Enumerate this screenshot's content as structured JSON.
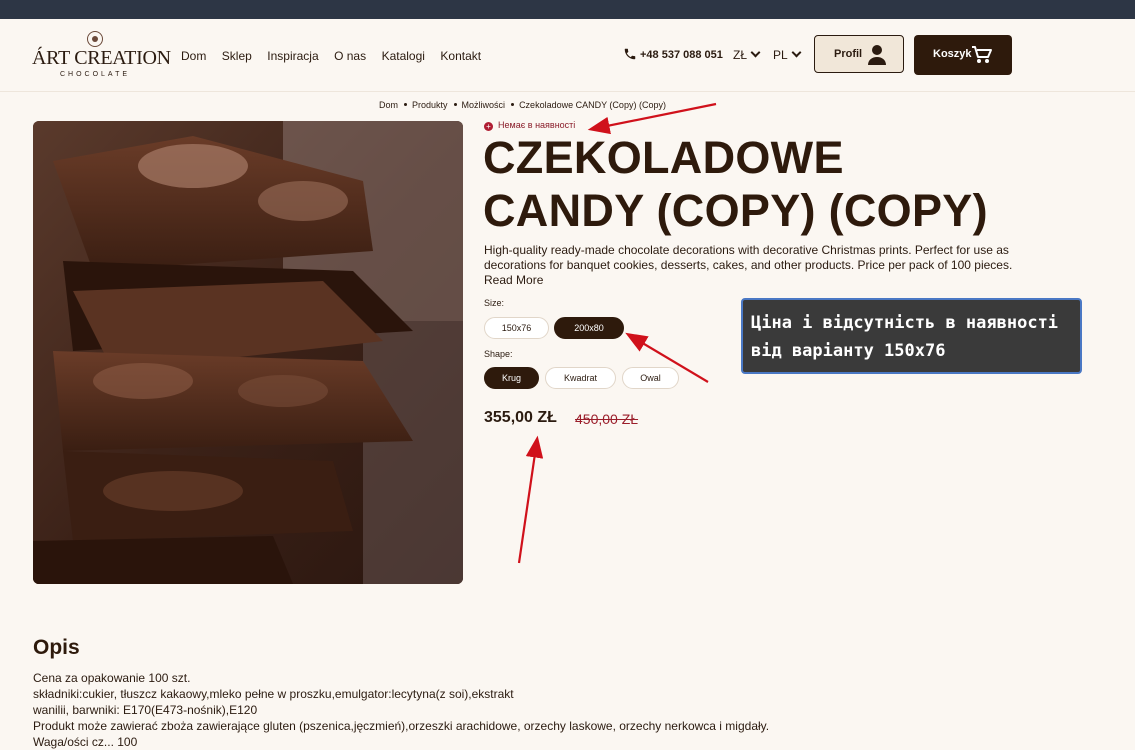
{
  "brand": {
    "name": "ÁRT CREATION",
    "tagline": "CHOCOLATE"
  },
  "nav": [
    "Dom",
    "Sklep",
    "Inspiracja",
    "O nas",
    "Katalogi",
    "Kontakt"
  ],
  "header": {
    "phone": "+48 537 088 051",
    "currency": "ZŁ",
    "language": "PL",
    "profile_label": "Profil",
    "cart_label": "Koszyk"
  },
  "breadcrumb": [
    "Dom",
    "Produkty",
    "Możliwości",
    "Czekoladowe CANDY (Copy) (Copy)"
  ],
  "product": {
    "stock_status": "Немає в наявності",
    "title_line1": "CZEKOLADOWE",
    "title_line2": "CANDY (COPY) (COPY)",
    "description": "High-quality ready-made chocolate decorations with decorative Christmas prints. Perfect for use as decorations for banquet cookies, desserts, cakes, and other products. Price per pack of 100 pieces.",
    "read_more": "Read More",
    "size_label": "Size:",
    "sizes": [
      "150x76",
      "200x80"
    ],
    "selected_size": "200x80",
    "shape_label": "Shape:",
    "shapes": [
      "Krug",
      "Kwadrat",
      "Owal"
    ],
    "selected_shape": "Krug",
    "price": "355,00 ZŁ",
    "old_price": "450,00 ZŁ"
  },
  "annotation": {
    "line1": "Ціна і відсутність в наявності",
    "line2": "від варіанту 150x76"
  },
  "opis": {
    "title": "Opis",
    "lines": [
      "Cena za opakowanie 100 szt.",
      "składniki:cukier, tłuszcz kakaowy,mleko pełne w proszku,emulgator:lecytyna(z soi),ekstrakt",
      "wanilii, barwniki: E170(E473-nośnik),E120",
      "Produkt może zawierać zboża zawierające gluten (pszenica,jęczmień),orzeszki arachidowe, orzechy laskowe, orzechy nerkowca i migdały.",
      "Waga/ości cz...   100"
    ]
  },
  "colors": {
    "dark_brown": "#2e1a0c",
    "cream": "#fbf7f2",
    "accent_red": "#b01e33",
    "arrow_red": "#d0111b"
  }
}
